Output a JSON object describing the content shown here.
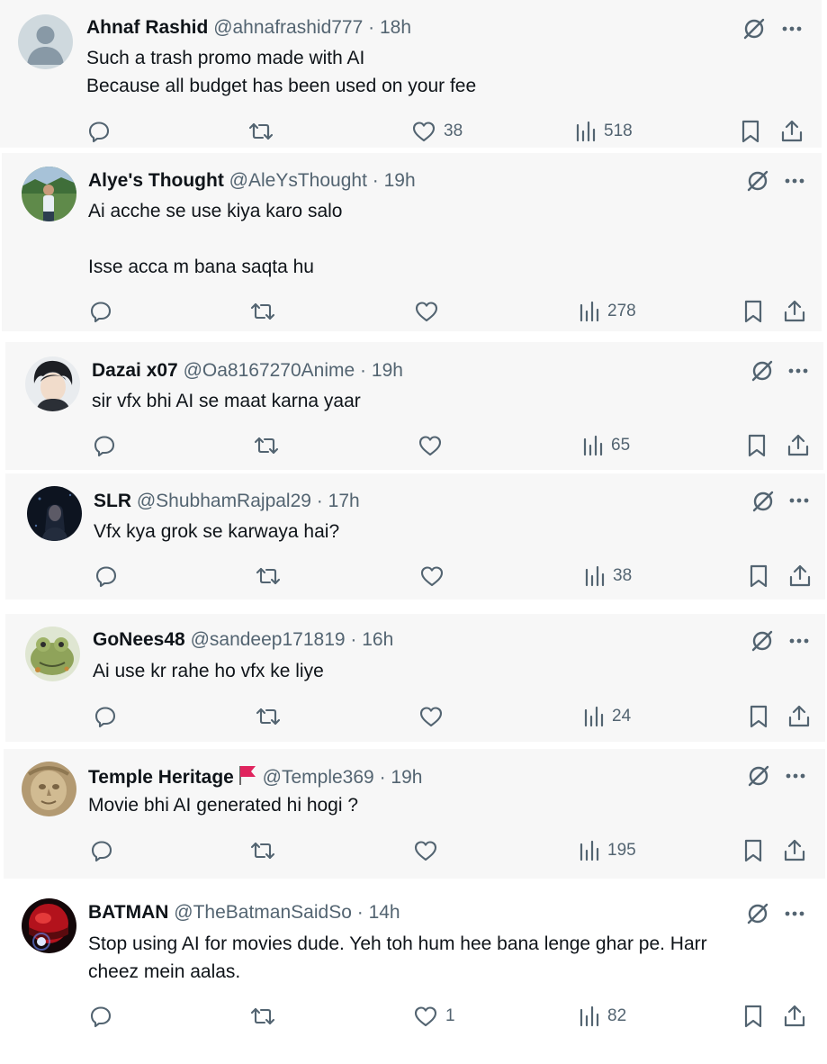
{
  "tweets": [
    {
      "name": "Ahnaf Rashid",
      "handle": "@ahnafrashid777",
      "separator": "·",
      "time": "18h",
      "text": "Such a trash promo made with AI\nBecause all budget has been used on your fee",
      "likes": "38",
      "views": "518",
      "avatar": "default-person"
    },
    {
      "name": "Alye's Thought",
      "handle": "@AleYsThought",
      "separator": "·",
      "time": "19h",
      "text": "Ai acche se use kiya karo salo\n\nIsse acca m bana saqta hu",
      "likes": "",
      "views": "278",
      "avatar": "outdoor-photo"
    },
    {
      "name": "Dazai x07",
      "handle": "@Oa8167270Anime",
      "separator": "·",
      "time": "19h",
      "text": "sir vfx bhi AI se maat karna yaar",
      "likes": "",
      "views": "65",
      "avatar": "anime-character"
    },
    {
      "name": "SLR",
      "handle": "@ShubhamRajpal29",
      "separator": "·",
      "time": "17h",
      "text": "Vfx kya grok se karwaya hai?",
      "likes": "",
      "views": "38",
      "avatar": "dark-photo"
    },
    {
      "name": "GoNees48",
      "handle": "@sandeep171819",
      "separator": "·",
      "time": "16h",
      "text": "Ai use kr rahe ho vfx ke liye",
      "likes": "",
      "views": "24",
      "avatar": "frog-cartoon"
    },
    {
      "name": "Temple Heritage",
      "handle": "@Temple369",
      "separator": "·",
      "time": "19h",
      "text": "Movie bhi AI generated hi hogi ?",
      "likes": "",
      "views": "195",
      "avatar": "stone-sculpture",
      "flag": "red-flag"
    },
    {
      "name": "BATMAN",
      "handle": "@TheBatmanSaidSo",
      "separator": "·",
      "time": "14h",
      "text": "Stop using AI for movies dude. Yeh toh hum hee bana lenge ghar pe. Harr\ncheez mein aalas.",
      "likes": "1",
      "views": "82",
      "avatar": "red-helmet"
    }
  ],
  "colors": {
    "card_background": "#f7f7f7",
    "text_primary": "#0f1419",
    "text_secondary": "#536471",
    "flag": "#e0245e"
  },
  "icons": [
    "reply-icon",
    "retweet-icon",
    "like-icon",
    "views-icon",
    "bookmark-icon",
    "share-icon",
    "grok-icon",
    "more-icon"
  ]
}
